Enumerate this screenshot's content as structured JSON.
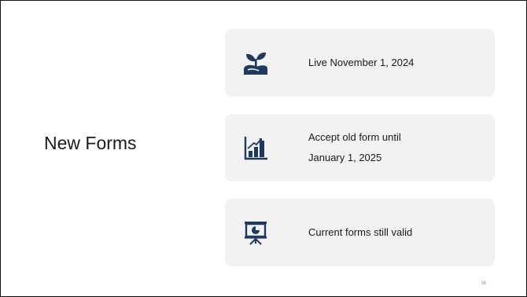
{
  "slide": {
    "title": "New Forms",
    "page_number": "16",
    "accent_color": "#1f3a5f",
    "card_background": "#f2f2f2",
    "items": [
      {
        "icon": "seedling-icon",
        "text": "Live November 1, 2024"
      },
      {
        "icon": "bar-chart-growth-icon",
        "text_line1": "Accept old form until",
        "text_line2": "January 1, 2025"
      },
      {
        "icon": "presentation-board-icon",
        "text": "Current forms still valid"
      }
    ]
  }
}
